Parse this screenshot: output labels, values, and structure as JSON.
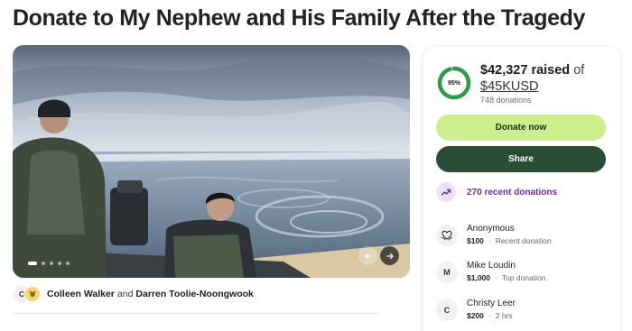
{
  "page": {
    "title": "Donate to My Nephew and His Family After the Tragedy"
  },
  "gallery": {
    "dot_count": 5,
    "active_index": 0
  },
  "organizers": {
    "avatar_letter": "C",
    "first": "Colleen Walker",
    "joiner": "and",
    "second": "Darren Toolie-Noongwook"
  },
  "sidebar": {
    "progress_percent": 95,
    "progress_label": "95%",
    "raised_amount": "$42,327 raised",
    "raised_of": "of",
    "goal": "$45KUSD",
    "donation_count": "748 donations",
    "donate_label": "Donate now",
    "share_label": "Share",
    "recent_label": "270 recent donations",
    "accent_color": "#2e9a4a",
    "donate_color": "#cdee8c",
    "share_color": "#2a4e35",
    "recent_color": "#6e2ca3",
    "donors": [
      {
        "avatar": "heart-hands-icon",
        "name": "Anonymous",
        "amount": "$100",
        "separator": "·",
        "note": "Recent donation"
      },
      {
        "avatar": "M",
        "name": "Mike Loudin",
        "amount": "$1,000",
        "separator": "·",
        "note": "Top donation"
      },
      {
        "avatar": "C",
        "name": "Christy Leer",
        "amount": "$200",
        "separator": "·",
        "note": "2 hrs"
      }
    ]
  }
}
